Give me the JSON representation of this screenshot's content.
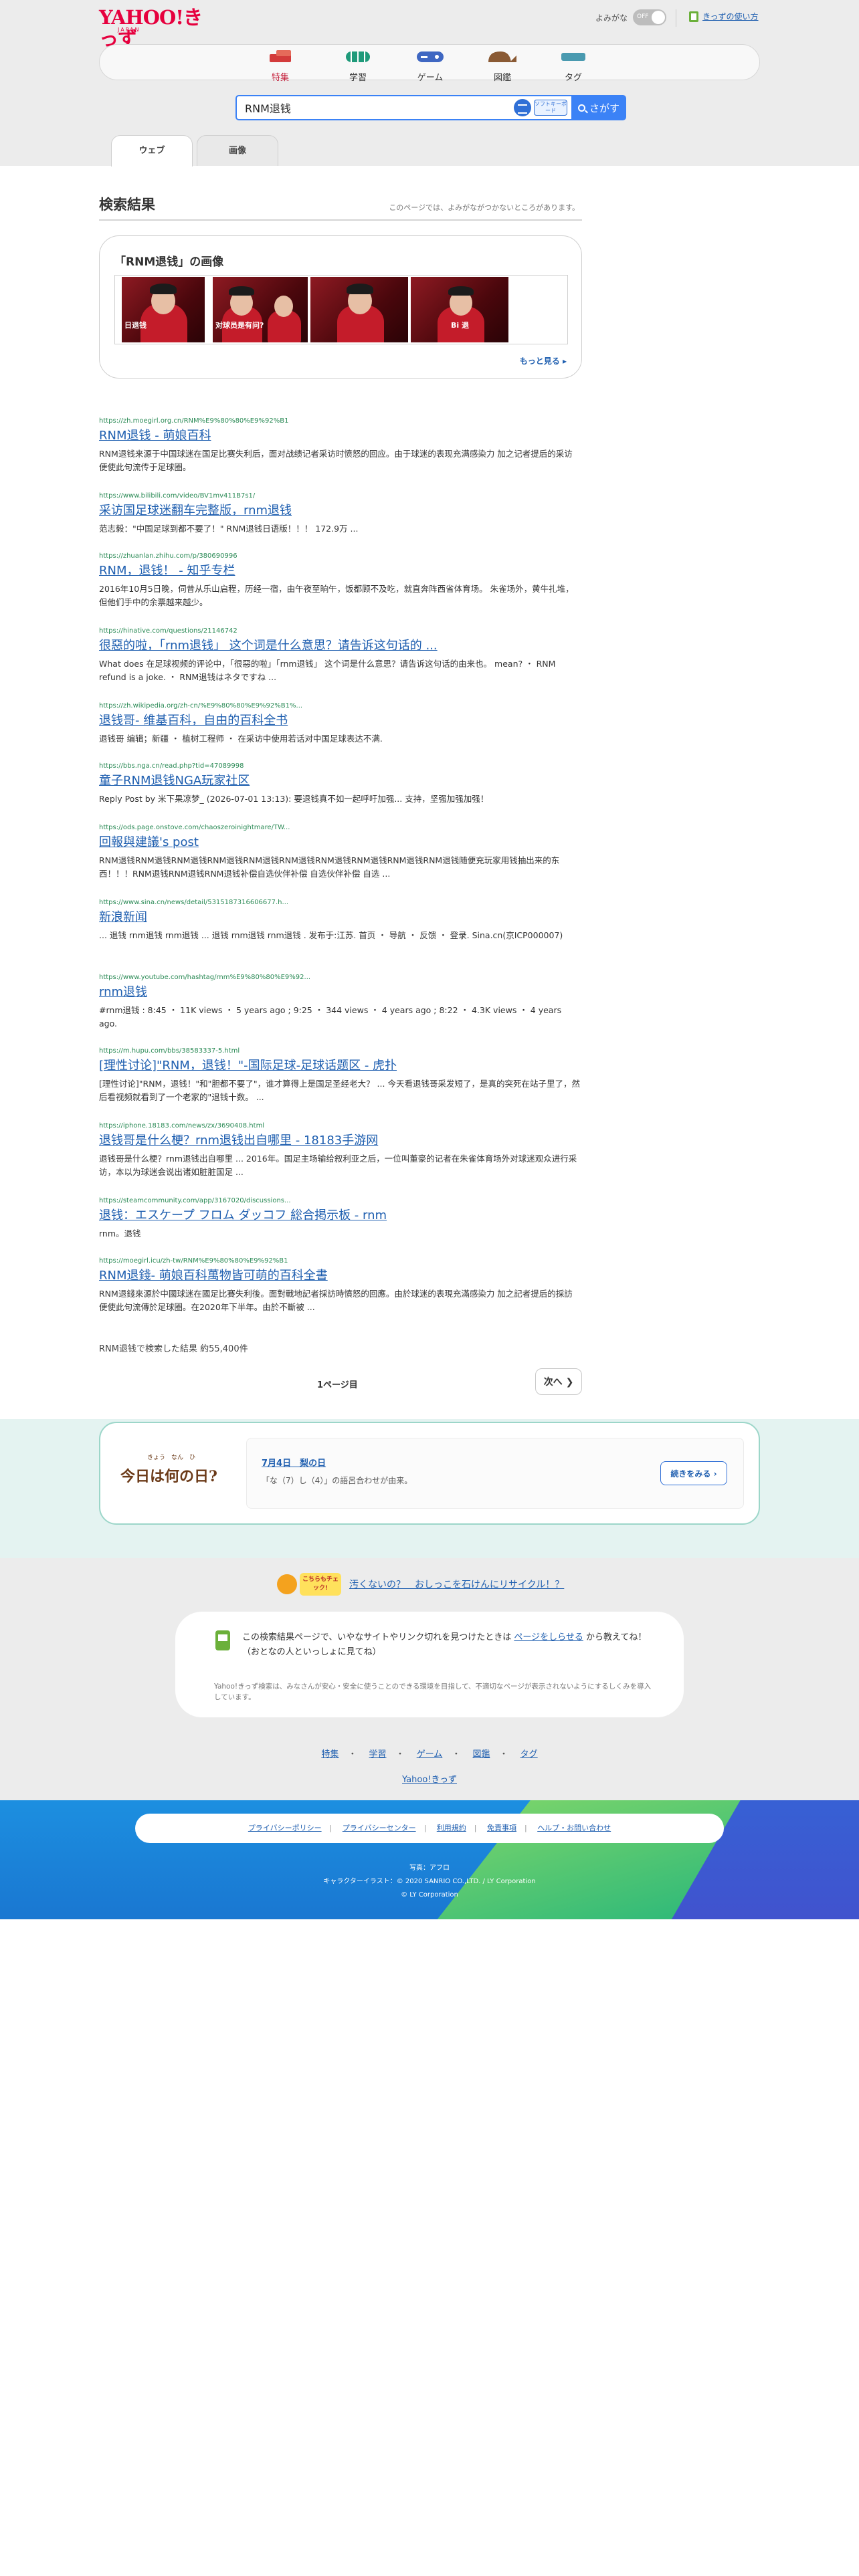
{
  "header": {
    "logo_main": "YAHOO!きっず",
    "logo_sub": "JAPAN",
    "furigana_label": "よみがな",
    "furigana_state": "OFF",
    "howto_label": "きっずの使い方"
  },
  "categories": [
    {
      "label": "特集",
      "color": "#d33b3b"
    },
    {
      "label": "学習",
      "color": "#1f9a7a"
    },
    {
      "label": "ゲーム",
      "color": "#3f67c2"
    },
    {
      "label": "図鑑",
      "color": "#8a5a34"
    },
    {
      "label": "タグ",
      "color": "#4a9ab0"
    }
  ],
  "search": {
    "query": "RNM退钱",
    "keyboard_label": "ソフトキーボード",
    "button_label": "さがす"
  },
  "tabs": [
    {
      "label": "ウェブ",
      "active": true
    },
    {
      "label": "画像",
      "active": false
    }
  ],
  "results_header": {
    "title": "検索結果",
    "note": "このページでは、よみがながつかないところがあります。"
  },
  "image_box": {
    "title": "「RNM退钱」の画像",
    "captions": [
      "日退钱",
      "对球员是有问?",
      "",
      "Bi 退"
    ],
    "more_label": "もっと見る"
  },
  "results": [
    {
      "url": "https://zh.moegirl.org.cn/RNM%E9%80%80%E9%92%B1",
      "title": "RNM退钱 - 萌娘百科",
      "snippet": "RNM退钱来源于中国球迷在国足比赛失利后，面对战绩记者采访时愤怒的回应。由于球迷的表现充满感染力 加之记者提后的采访 便使此句流传于足球圈。"
    },
    {
      "url": "https://www.bilibili.com/video/BV1mv411B7s1/",
      "title": "采访国足球迷翻车完整版，rnm退钱",
      "snippet": "范志毅：\"中国足球到都不要了！\" RNM退钱日语版！！！ 172.9万 ..."
    },
    {
      "url": "https://zhuanlan.zhihu.com/p/380690996",
      "title": "RNM，退钱！ - 知乎专栏",
      "snippet": "2016年10月5日晚，伺昔从乐山启程，历经一宿，由午夜至晌午，饭都顾不及吃，就直奔阵西省体育场。 朱雀场外，黄牛扎堆，但他们手中的余票越来越少。"
    },
    {
      "url": "https://hinative.com/questions/21146742",
      "title": "很惡的啦，「rnm退钱」 这个词是什么意思？请告诉这句话的 ...",
      "snippet": "What does 在足球视频的评论中，「很惡的啦」「rnm退钱」 这个词是什么意思？请告诉这句话的由来也。 mean? ・ RNM refund is a joke. ・ RNM退钱はネタですね ..."
    },
    {
      "url": "https://zh.wikipedia.org/zh-cn/%E9%80%80%E9%92%B1%...",
      "title": "退钱哥- 维基百科，自由的百科全书",
      "snippet": "退钱哥 编辑；新疆 ・ 植树工程师 ・ 在采访中使用若话对中国足球表达不满."
    },
    {
      "url": "https://bbs.nga.cn/read.php?tid=47089998",
      "title": "童子RNM退钱NGA玩家社区",
      "snippet": "Reply Post by 米下果凉梦_ (2026-07-01 13:13): 要退钱真不如一起呼吁加强... 支持，坚强加强加强！"
    },
    {
      "url": "https://ods.page.onstove.com/chaoszeroinightmare/TW...",
      "title": "回報與建議's post",
      "snippet": "RNM退钱RNM退钱RNM退钱RNM退钱RNM退钱RNM退钱RNM退钱RNM退钱RNM退钱RNM退钱随便充玩家用钱抽出来的东西！！！RNM退钱RNM退钱RNM退钱补偿自选伙伴补偿 自选伙伴补偿 自选 ..."
    },
    {
      "url": "https://www.sina.cn/news/detail/5315187316606677.h...",
      "title": "新浪新闻",
      "snippet": "... 退钱 rnm退钱 rnm退钱 ... 退钱 rnm退钱 rnm退钱 . 发布于:江苏. 首页 ・ 导航 ・ 反馈 ・ 登录. Sina.cn(京ICP000007)"
    },
    {
      "url": "https://www.youtube.com/hashtag/rnm%E9%80%80%E9%92...",
      "title": "rnm退钱",
      "snippet": "#rnm退钱 : 8:45 ・ 11K views ・ 5 years ago ; 9:25 ・ 344 views ・ 4 years ago ; 8:22 ・ 4.3K views ・ 4 years ago."
    },
    {
      "url": "https://m.hupu.com/bbs/38583337-5.html",
      "title": "[理性讨论]\"RNM，退钱！\"-国际足球-足球话题区 - 虎扑",
      "snippet": "[理性讨论]\"RNM，退钱！\"和\"胆都不要了\"，谁才算得上是国足圣经老大？ ... 今天看退钱哥采发短了，是真的突死在站子里了，然后看视频就看到了一个老家的\"退钱十数。 ..."
    },
    {
      "url": "https://iphone.18183.com/news/zx/3690408.html",
      "title": "退钱哥是什么梗？rnm退钱出自哪里 - 18183手游网",
      "snippet": "退钱哥是什么梗？rnm退钱出自哪里 ... 2016年。国足主场输给叙利亚之后，一位叫董豪的记者在朱雀体育场外对球迷观众进行采访，本以为球迷会说出诸如脏脏国足 ..."
    },
    {
      "url": "https://steamcommunity.com/app/3167020/discussions...",
      "title": "退钱：エスケープ フロム ダッコフ 総合掲示板 - rnm",
      "snippet": "rnm。退钱"
    },
    {
      "url": "https://moegirl.icu/zh-tw/RNM%E9%80%80%E9%92%B1",
      "title": "RNM退錢- 萌娘百科萬物皆可萌的百科全書",
      "snippet": "RNM退錢來源於中國球迷在國足比賽失利後。面對戰地記者採訪時憤怒的回應。由於球迷的表現充滿感染力 加之記者提后的採訪 便使此句流傳於足球圈。在2020年下半年。由於不斷被 ..."
    }
  ],
  "pagination": {
    "count_text": "RNM退钱で検索した結果 約55,400件",
    "page_text": "1ページ目",
    "next_label": "次へ"
  },
  "today": {
    "logo_text": "今日は何の日?",
    "logo_ruby": "きょう　なん　ひ",
    "date": "7月4日　梨の日",
    "text": "「な（7）し（4）」の語呂合わせが由来。",
    "more_label": "続きをみる"
  },
  "footer": {
    "badge_text": "こちらもチェック!",
    "recycle_link": "汚くないの？　おしっこを石けんにリサイクル！？",
    "report_before": "この検索結果ページで、いやなサイトやリンク切れを見つけたときは",
    "report_link": "ページをしらせる",
    "report_after": "から教えてね！",
    "report_note": "（おとなの人といっしょに見てね）",
    "report_small": "Yahoo!きっず検索は、みなさんが安心・安全に使うことのできる環境を目指して、不適切なページが表示されないようにするしくみを導入しています。",
    "links": [
      "特集",
      "学習",
      "ゲーム",
      "図鑑",
      "タグ"
    ],
    "home_link": "Yahoo!きっず",
    "policy_links": [
      "プライバシーポリシー",
      "プライバシーセンター",
      "利用規約",
      "免責事項",
      "ヘルプ・お問い合わせ"
    ],
    "credits": [
      "写真：アフロ",
      "キャラクターイラスト：© 2020 SANRIO CO.,LTD. / LY Corporation",
      "© LY Corporation"
    ]
  }
}
